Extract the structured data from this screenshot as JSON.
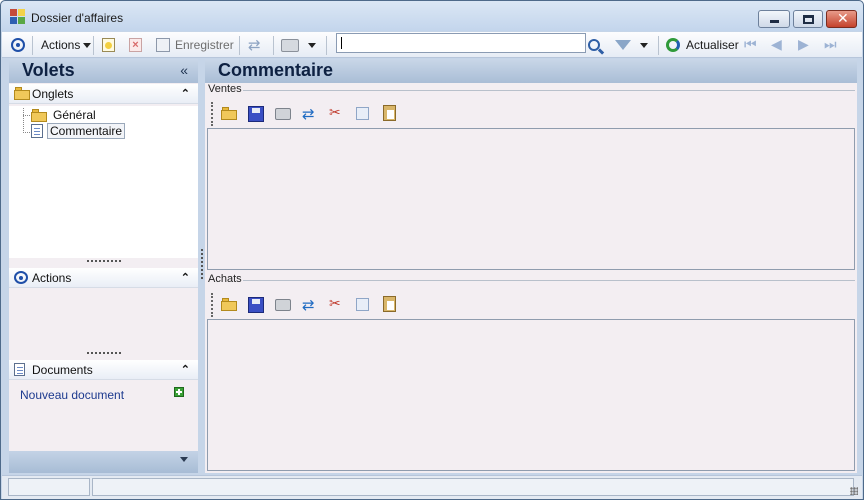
{
  "window": {
    "title": "Dossier d'affaires"
  },
  "toolbar": {
    "actions_label": "Actions",
    "save_label": "Enregistrer",
    "search_value": "",
    "refresh_label": "Actualiser"
  },
  "left": {
    "header": "Volets",
    "collapse_glyph": "«",
    "sections": {
      "onglets": {
        "label": "Onglets",
        "items": [
          "Général",
          "Commentaire"
        ],
        "selected": "Commentaire"
      },
      "actions": {
        "label": "Actions"
      },
      "documents": {
        "label": "Documents",
        "new_document": "Nouveau document"
      }
    },
    "chevron_glyph": "⌃"
  },
  "main": {
    "header": "Commentaire",
    "groups": [
      {
        "label": "Ventes",
        "text": ""
      },
      {
        "label": "Achats",
        "text": ""
      }
    ]
  },
  "icons": {
    "mini_toolbar": [
      "folder-open-icon",
      "save-icon",
      "print-icon",
      "sync-icon",
      "cut-icon",
      "copy-icon",
      "paste-icon"
    ]
  },
  "colors": {
    "header_text": "#0e2142",
    "panel_bg": "#f3eef2",
    "header_gradient_top": "#c9d7e8",
    "header_gradient_bottom": "#a9bdd6",
    "link": "#1d3a8f"
  }
}
